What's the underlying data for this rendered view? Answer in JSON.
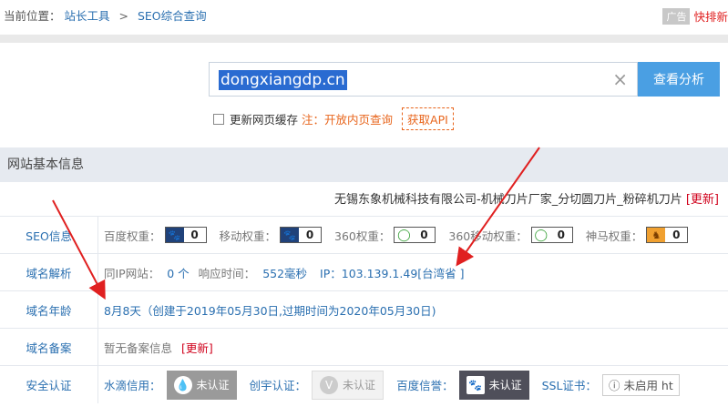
{
  "breadcrumb": {
    "prefix": "当前位置：",
    "tools": "站长工具",
    "sep": ">",
    "current": "SEO综合查询"
  },
  "ad": {
    "tag": "广告",
    "text": "快排新"
  },
  "search": {
    "value": "dongxiangdp.cn",
    "clear_glyph": "×",
    "button": "查看分析"
  },
  "refresh": {
    "label": "更新网页缓存",
    "note": "注：开放内页查询",
    "api": "获取API"
  },
  "panel": {
    "title": "网站基本信息"
  },
  "company": {
    "name": "无锡东象机械科技有限公司-机械刀片厂家_分切圆刀片_粉碎机刀片",
    "update": "[更新]"
  },
  "seo": {
    "label": "SEO信息",
    "items": [
      {
        "name": "百度权重：",
        "value": "0",
        "icon": "paw-icon"
      },
      {
        "name": "移动权重：",
        "value": "0",
        "icon": "paw-icon"
      },
      {
        "name": "360权重：",
        "value": "0",
        "icon": "ring-icon"
      },
      {
        "name": "360移动权重：",
        "value": "0",
        "icon": "ring-icon"
      },
      {
        "name": "神马权重：",
        "value": "0",
        "icon": "horse-icon"
      }
    ]
  },
  "dns": {
    "label": "域名解析",
    "same_ip_label": "同IP网站：",
    "same_ip_value": "0 个",
    "resp_label": "响应时间：",
    "resp_value": "552毫秒",
    "ip": "IP：103.139.1.49[台湾省 ]"
  },
  "age": {
    "label": "域名年龄",
    "value": "8月8天（创建于2019年05月30日,过期时间为2020年05月30日)"
  },
  "beian": {
    "label": "域名备案",
    "value": "暂无备案信息",
    "update": "[更新]"
  },
  "security": {
    "label": "安全认证",
    "water": {
      "label": "水滴信用：",
      "badge": "未认证"
    },
    "chuangyu": {
      "label": "创宇认证：",
      "badge": "未认证"
    },
    "baidu": {
      "label": "百度信誉：",
      "badge": "未认证"
    },
    "ssl": {
      "label": "SSL证书：",
      "value": "未启用 ht"
    }
  },
  "colors": {
    "accent": "#4a9fe3",
    "link": "#2a6fb0",
    "arrow": "#e02020"
  }
}
